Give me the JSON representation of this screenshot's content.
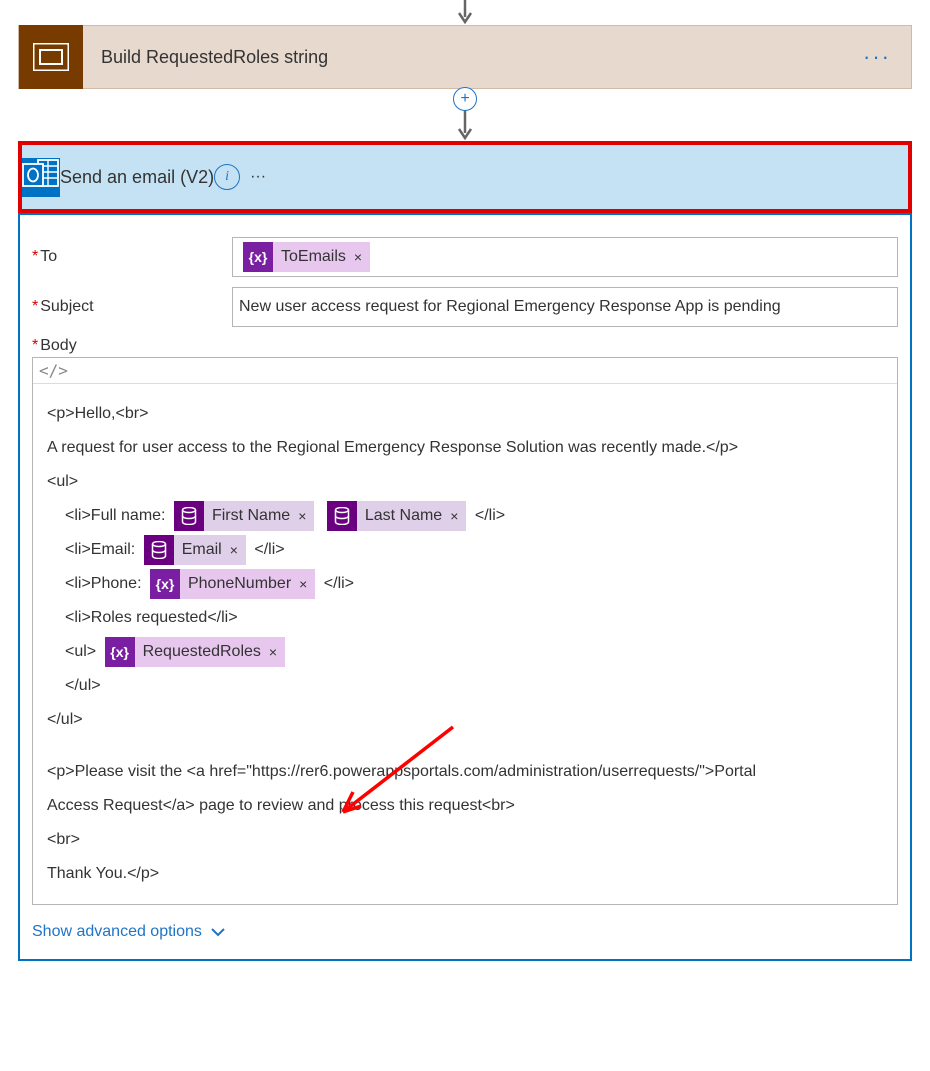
{
  "actions": {
    "build": {
      "title": "Build RequestedRoles string"
    },
    "send": {
      "title": "Send an email (V2)"
    }
  },
  "tokens": {
    "toEmails": "ToEmails",
    "firstName": "First Name",
    "lastName": "Last Name",
    "email": "Email",
    "phoneNumber": "PhoneNumber",
    "requestedRoles": "RequestedRoles",
    "exprIconLabel": "{x}"
  },
  "fields": {
    "to": {
      "label": "To"
    },
    "subject": {
      "label": "Subject",
      "value": "New user access request for Regional Emergency Response App is pending"
    },
    "body": {
      "label": "Body",
      "codeToggle": "</>",
      "lines": {
        "l1": "<p>Hello,<br>",
        "l2": "A request for user access to the Regional Emergency Response Solution was recently made.</p>",
        "l3": "<ul>",
        "l4a": "<li>Full name:",
        "l4b": "</li>",
        "l5a": "<li>Email:",
        "l5b": "</li>",
        "l6a": "<li>Phone:",
        "l6b": "</li>",
        "l7": "<li>Roles requested</li>",
        "l8": "<ul>",
        "l9": "</ul>",
        "l10": "</ul>",
        "l11a": "<p>Please visit the <a href=\"https://rer6.powerappsportals.com/administration/userrequests/\">Portal",
        "l11b": "Access Request</a> page to review and process this request<br>",
        "l12": "<br>",
        "l13": "Thank You.</p>"
      }
    }
  },
  "showAdvanced": "Show advanced options",
  "symbols": {
    "required": "*",
    "tokenClose": "×",
    "plus": "+",
    "info": "i",
    "ellipsis": "···"
  }
}
